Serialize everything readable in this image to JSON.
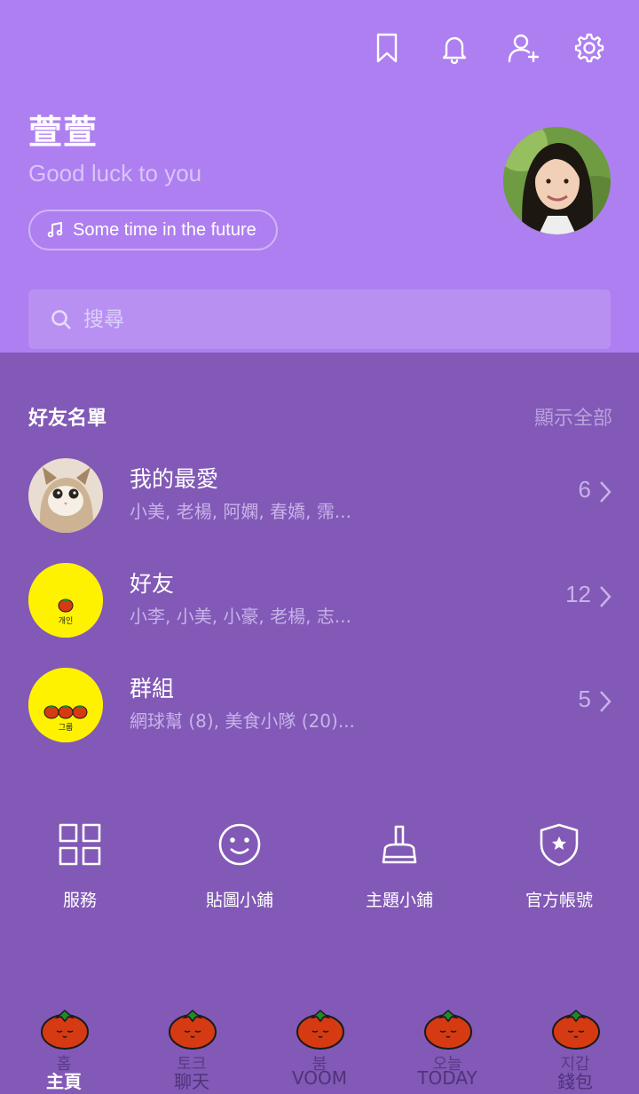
{
  "header": {
    "icons": [
      "bookmark-icon",
      "bell-icon",
      "add-friend-icon",
      "gear-icon"
    ]
  },
  "profile": {
    "name": "萱萱",
    "status": "Good luck to you",
    "music": "Some time in the future"
  },
  "search": {
    "placeholder": "搜尋"
  },
  "friends_section": {
    "title": "好友名單",
    "show_all": "顯示全部",
    "rows": [
      {
        "title": "我的最愛",
        "subtitle": "小美, 老楊, 阿嫻, 春嬌, 霈...",
        "count": "6"
      },
      {
        "title": "好友",
        "subtitle": "小李, 小美, 小豪, 老楊, 志...",
        "count": "12",
        "badge_text": "개인"
      },
      {
        "title": "群組",
        "subtitle": "網球幫 (8), 美食小隊 (20)...",
        "count": "5",
        "badge_text": "그룹"
      }
    ]
  },
  "services": [
    {
      "label": "服務"
    },
    {
      "label": "貼圖小鋪"
    },
    {
      "label": "主題小鋪"
    },
    {
      "label": "官方帳號"
    }
  ],
  "tabs": [
    {
      "kr": "홈",
      "label": "主頁"
    },
    {
      "kr": "토크",
      "label": "聊天"
    },
    {
      "kr": "붐",
      "label": "VOOM"
    },
    {
      "kr": "오늘",
      "label": "TODAY"
    },
    {
      "kr": "지갑",
      "label": "錢包"
    }
  ],
  "colors": {
    "header_bg": "#ae7ff0",
    "body_bg": "#8259b6",
    "badge_yellow": "#fff200",
    "tomato": "#d63a12"
  }
}
